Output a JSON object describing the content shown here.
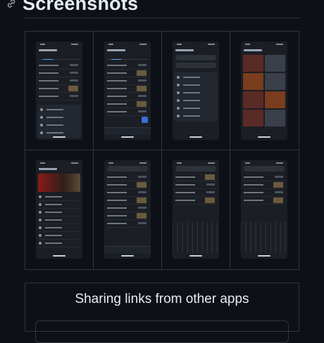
{
  "section": {
    "title": "Screenshots",
    "icon": "link-icon"
  },
  "screenshots": {
    "count": 8
  },
  "card": {
    "title": "Sharing links from other apps"
  },
  "colors": {
    "background": "#0d1117",
    "border": "#30363d",
    "text": "#e6edf3",
    "accent": "#58a6ff"
  }
}
